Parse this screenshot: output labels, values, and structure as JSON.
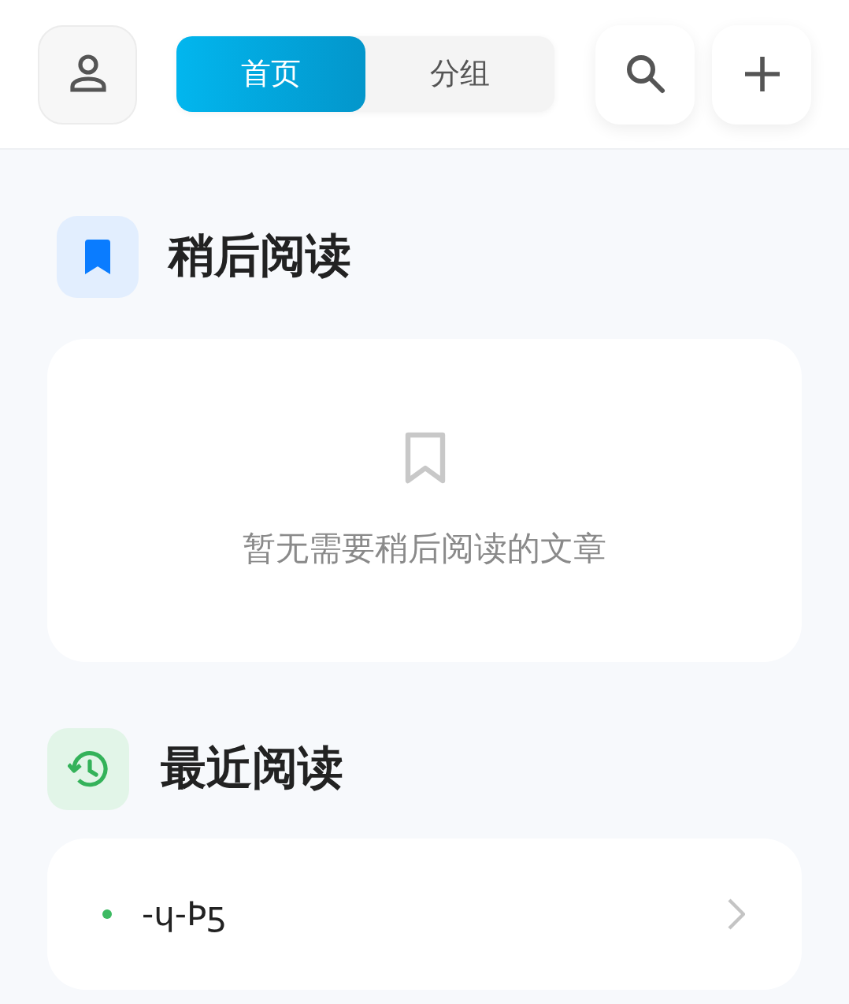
{
  "tabs": [
    {
      "label": "首页",
      "selected": true
    },
    {
      "label": "分组",
      "selected": false
    }
  ],
  "sections": [
    {
      "kind": "later",
      "title": "稍后阅读",
      "empty_text": "暂无需要稍后阅读的文章"
    },
    {
      "kind": "recent",
      "title": "最近阅读",
      "items": [
        {
          "title": "-ɥ-Þƽ",
          "color": "#3dba62"
        }
      ]
    }
  ]
}
